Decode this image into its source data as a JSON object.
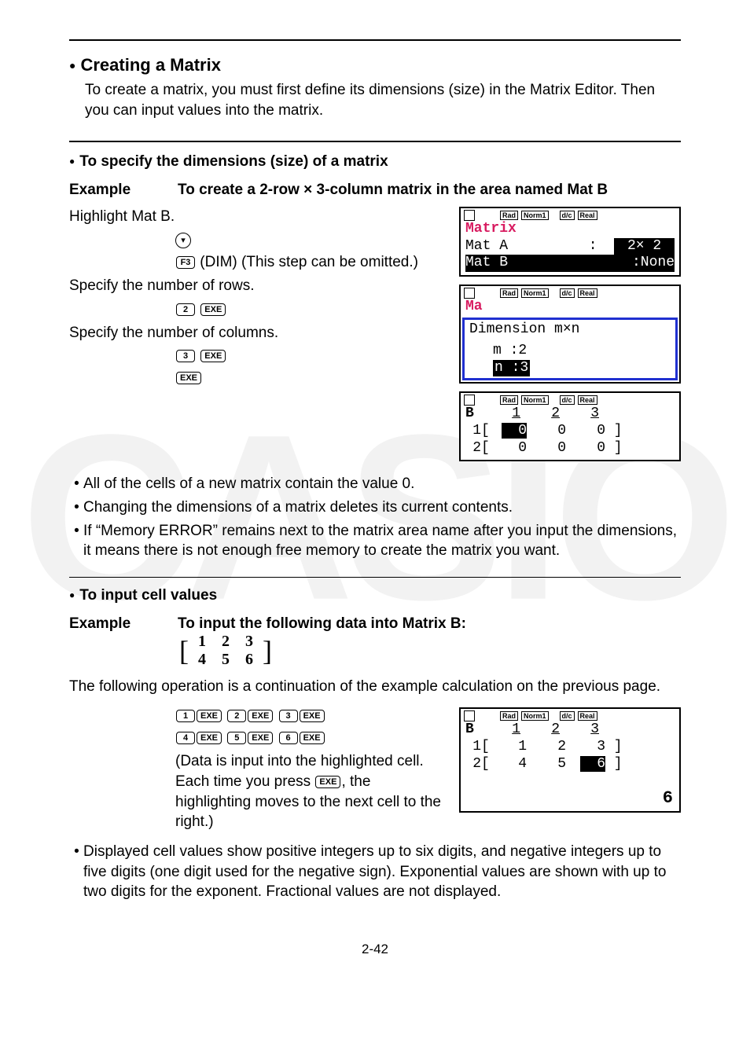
{
  "watermark": "CASIO",
  "section1": {
    "title": "Creating a Matrix",
    "intro": "To create a matrix, you must first define its dimensions (size) in the Matrix Editor. Then you can input values into the matrix."
  },
  "sub1": {
    "title": "To specify the dimensions (size) of a matrix",
    "example_label": "Example",
    "example_text_pre": "To create a 2-row ",
    "example_text_post": " 3-column matrix in the area named Mat B",
    "steps": {
      "highlight": "Highlight Mat B.",
      "dim_note": "(DIM) (This step can be omitted.)",
      "rows_label": "Specify the number of rows.",
      "cols_label": "Specify the number of columns."
    },
    "keys": {
      "f3": "F3",
      "two": "2",
      "three": "3",
      "exe": "EXE"
    },
    "notes": [
      "All of the cells of a new matrix contain the value 0.",
      "Changing the dimensions of a matrix deletes its current contents.",
      "If “Memory ERROR” remains next to the matrix area name after you input the dimensions, it means there is not enough free memory to create the matrix you want."
    ]
  },
  "calc1": {
    "status": [
      "Rad",
      "Norm1",
      "d/c",
      "Real"
    ],
    "title": "Matrix",
    "rowA_left": "Mat A",
    "rowA_right_dim": "2×  2",
    "rowB_left": "Mat B",
    "rowB_right": ":None"
  },
  "calc2": {
    "status": [
      "Rad",
      "Norm1",
      "d/c",
      "Real"
    ],
    "dlg_title": "Dimension m×n",
    "m": "m   :2",
    "n": "n   :3"
  },
  "calc3": {
    "status": [
      "Rad",
      "Norm1",
      "d/c",
      "Real"
    ],
    "name": "B",
    "cols": [
      "1",
      "2",
      "3"
    ],
    "rows": [
      [
        "0",
        "0",
        "0"
      ],
      [
        "0",
        "0",
        "0"
      ]
    ]
  },
  "sub2": {
    "title": "To input cell values",
    "example_label": "Example",
    "example_text": "To input the following data into Matrix B:",
    "matrix": [
      [
        "1",
        "2",
        "3"
      ],
      [
        "4",
        "5",
        "6"
      ]
    ],
    "cont": "The following operation is a continuation of the example calculation on the previous page.",
    "keys": {
      "k1": "1",
      "k2": "2",
      "k3": "3",
      "k4": "4",
      "k5": "5",
      "k6": "6",
      "exe": "EXE"
    },
    "input_note_pre": "(Data is input into the highlighted cell. Each time you press ",
    "input_note_post": ", the highlighting moves to the next cell to the right.)",
    "notes": [
      "Displayed cell values show positive integers up to six digits, and negative integers up to five digits (one digit used for the negative sign). Exponential values are shown with up to two digits for the exponent. Fractional values are not displayed."
    ]
  },
  "calc4": {
    "status": [
      "Rad",
      "Norm1",
      "d/c",
      "Real"
    ],
    "name": "B",
    "cols": [
      "1",
      "2",
      "3"
    ],
    "rows": [
      [
        "1",
        "2",
        "3"
      ],
      [
        "4",
        "5",
        "6"
      ]
    ],
    "big": "6"
  },
  "page_num": "2-42"
}
